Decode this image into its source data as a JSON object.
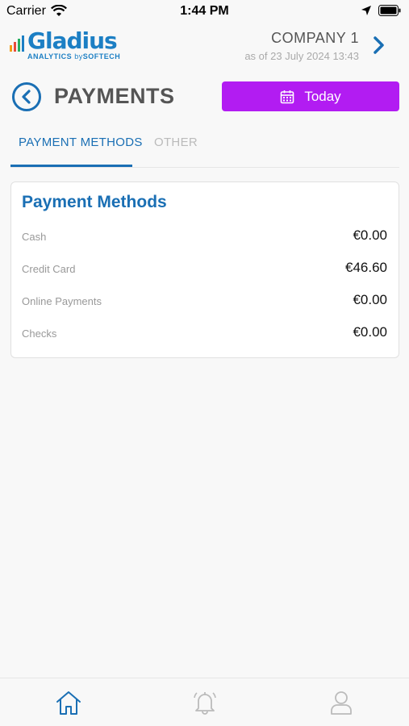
{
  "status": {
    "carrier": "Carrier",
    "time": "1:44 PM"
  },
  "header": {
    "logo_word": "Gladius",
    "logo_sub_analytics": "ANALYTICS",
    "logo_sub_by": "by",
    "logo_sub_soft": "SOF",
    "logo_sub_tech": "TECH",
    "company_name": "COMPANY 1",
    "as_of": "as of 23 July 2024 13:43"
  },
  "page": {
    "title": "PAYMENTS",
    "date_button": "Today"
  },
  "tabs": [
    {
      "label": "PAYMENT METHODS",
      "active": true
    },
    {
      "label": "OTHER",
      "active": false
    }
  ],
  "card": {
    "title": "Payment Methods",
    "rows": [
      {
        "label": "Cash",
        "value": "€0.00"
      },
      {
        "label": "Credit Card",
        "value": "€46.60"
      },
      {
        "label": "Online Payments",
        "value": "€0.00"
      },
      {
        "label": "Checks",
        "value": "€0.00"
      }
    ]
  },
  "bottom_nav": [
    {
      "icon": "home-icon",
      "active": true
    },
    {
      "icon": "bell-icon",
      "active": false
    },
    {
      "icon": "user-icon",
      "active": false
    }
  ],
  "colors": {
    "accent": "#1a6fb4",
    "button": "#b21cf2",
    "muted": "#999999"
  }
}
